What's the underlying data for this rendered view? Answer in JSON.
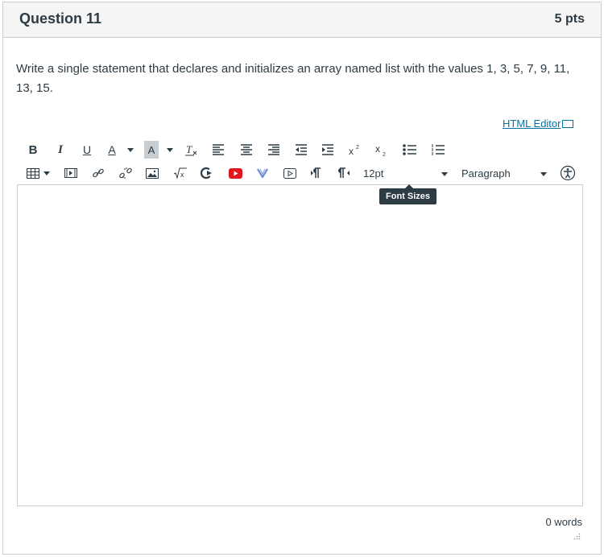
{
  "question": {
    "title": "Question 11",
    "points": "5 pts",
    "text": "Write a single statement that declares and initializes an array named list with the values 1, 3, 5, 7, 9, 11, 13, 15."
  },
  "editor": {
    "html_editor_link": "HTML Editor",
    "toolbar": {
      "bold": "B",
      "italic": "I",
      "underline": "U",
      "text_color": "A",
      "bg_color": "A",
      "font_size": "12pt",
      "format": "Paragraph"
    },
    "tooltip": "Font Sizes",
    "word_count": "0 words"
  }
}
